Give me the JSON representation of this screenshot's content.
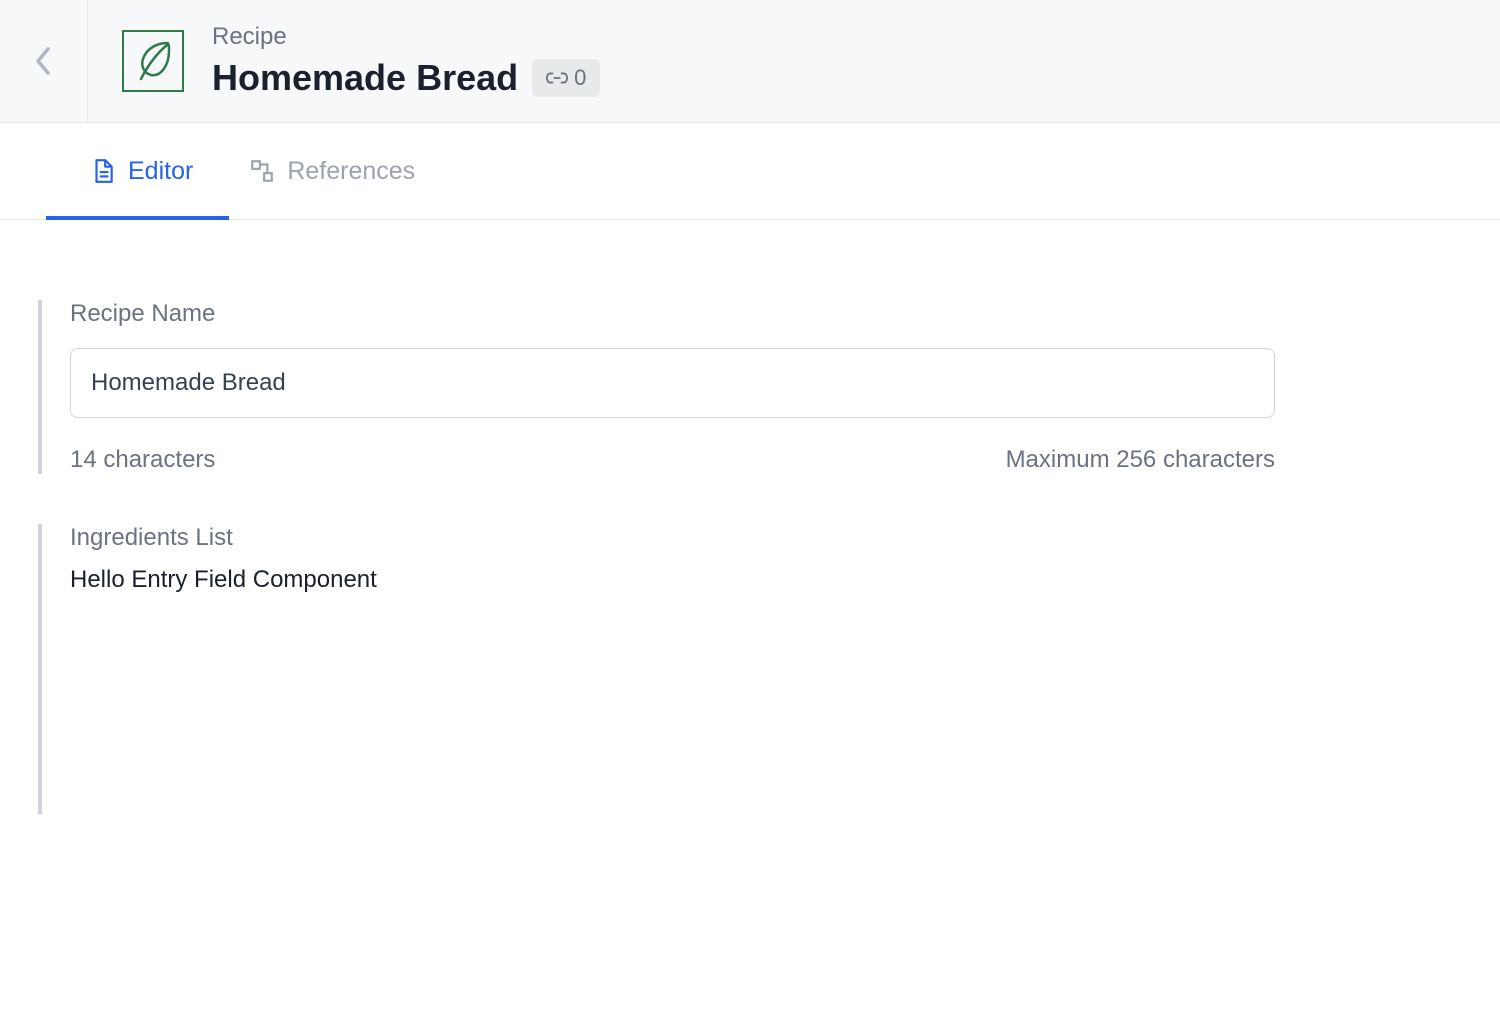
{
  "header": {
    "content_type_label": "Recipe",
    "entry_title": "Homemade Bread",
    "link_count": "0"
  },
  "tabs": {
    "editor_label": "Editor",
    "references_label": "References"
  },
  "fields": {
    "recipe_name": {
      "label": "Recipe Name",
      "value": "Homemade Bread",
      "char_count": "14 characters",
      "max_label": "Maximum 256 characters"
    },
    "ingredients": {
      "label": "Ingredients List",
      "content": "Hello Entry Field Component"
    }
  }
}
